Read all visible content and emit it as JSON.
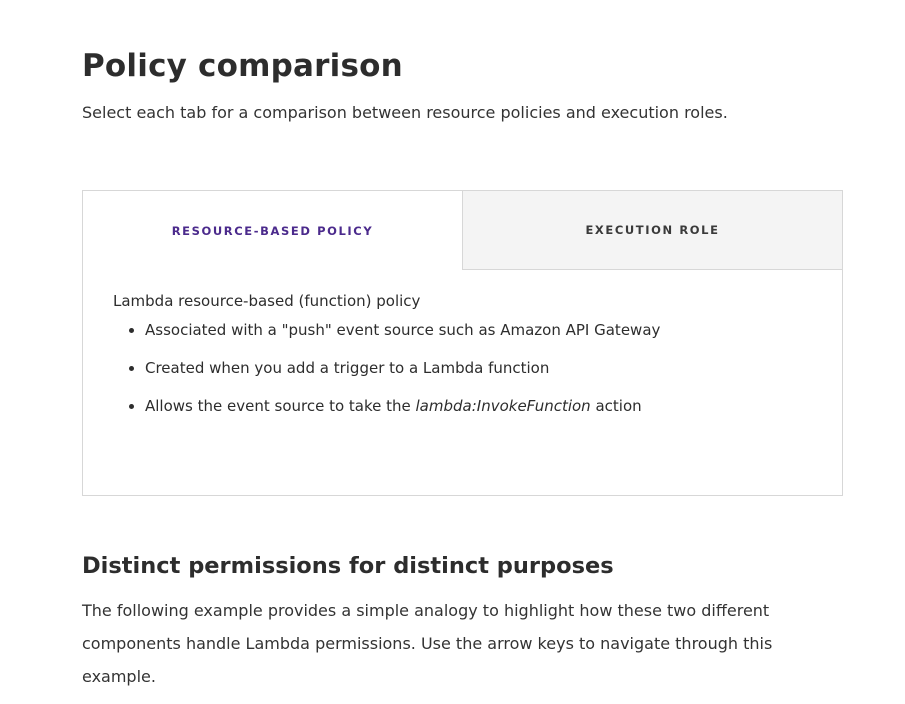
{
  "heading": "Policy comparison",
  "intro": "Select each tab for a comparison between resource policies and execution roles.",
  "tabs": [
    {
      "label": "RESOURCE-BASED POLICY",
      "active": true
    },
    {
      "label": "EXECUTION ROLE",
      "active": false
    }
  ],
  "panel": {
    "title": "Lambda resource-based (function) policy",
    "bullets": [
      "Associated with a \"push\" event source such as Amazon API Gateway",
      "Created when you add a trigger to a Lambda function"
    ],
    "bullet3_prefix": "Allows the event source to take the ",
    "bullet3_italic": "lambda:InvokeFunction",
    "bullet3_suffix": " action"
  },
  "section2": {
    "heading": "Distinct permissions for distinct purposes",
    "paragraph_line1": "The following example provides a simple analogy to highlight how these two different",
    "paragraph_line2": "components handle Lambda permissions. Use the arrow keys to navigate through this example."
  },
  "colors": {
    "active_tab_text": "#4b2a8c",
    "inactive_tab_bg": "#f4f4f4",
    "border": "#d7d7d7"
  }
}
